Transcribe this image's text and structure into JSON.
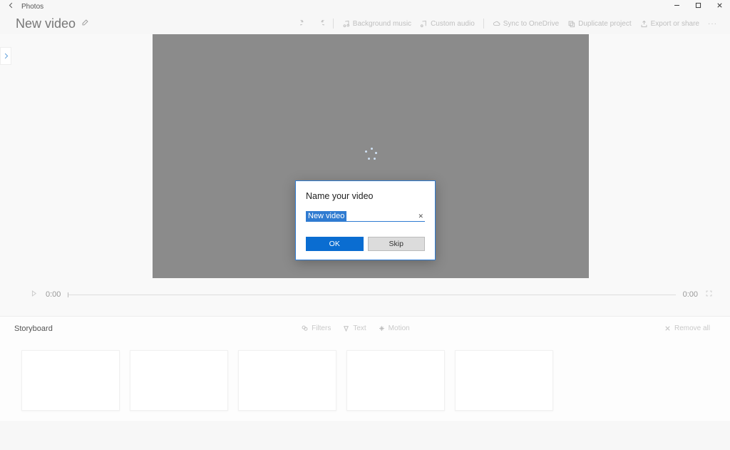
{
  "app": {
    "name": "Photos"
  },
  "project": {
    "title": "New video"
  },
  "toolbar": {
    "background_music": "Background music",
    "custom_audio": "Custom audio",
    "sync": "Sync to OneDrive",
    "duplicate": "Duplicate project",
    "export": "Export or share"
  },
  "transport": {
    "current_time": "0:00",
    "total_time": "0:00"
  },
  "storyboard": {
    "header": "Storyboard",
    "filters": "Filters",
    "text": "Text",
    "motion": "Motion",
    "remove_all": "Remove all"
  },
  "dialog": {
    "title": "Name your video",
    "value": "New video",
    "ok": "OK",
    "skip": "Skip"
  }
}
